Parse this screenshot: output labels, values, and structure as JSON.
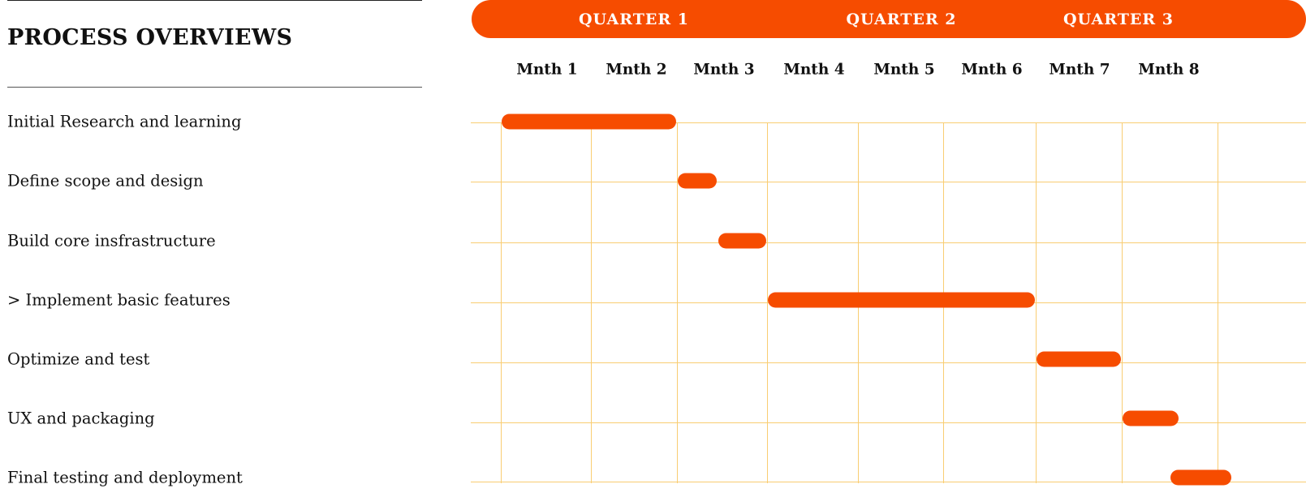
{
  "header": {
    "title": "PROCESS OVERVIEWS"
  },
  "timeline": {
    "accent_color": "#f64c00",
    "grid_color": "#f9cd72",
    "quarters": [
      {
        "label": "QUARTER 1",
        "months": [
          1,
          3
        ]
      },
      {
        "label": "QUARTER 2",
        "months": [
          4,
          6
        ]
      },
      {
        "label": "QUARTER 3",
        "months": [
          7,
          9
        ]
      }
    ],
    "months": [
      "Mnth 1",
      "Mnth 2",
      "Mnth 3",
      "Mnth 4",
      "Mnth 5",
      "Mnth 6",
      "Mnth 7",
      "Mnth 8"
    ]
  },
  "tasks": [
    {
      "label": "Initial Research and learning",
      "start_month": 1.0,
      "end_month": 3.0
    },
    {
      "label": "Define scope and design",
      "start_month": 3.0,
      "end_month": 3.45
    },
    {
      "label": "Build core insfrastructure",
      "start_month": 3.45,
      "end_month": 4.0
    },
    {
      "label": "> Implement basic features",
      "start_month": 4.0,
      "end_month": 7.0
    },
    {
      "label": "Optimize and test",
      "start_month": 7.0,
      "end_month": 8.0
    },
    {
      "label": "UX and packaging",
      "start_month": 8.0,
      "end_month": 8.6
    },
    {
      "label": "Final testing and deployment",
      "start_month": 8.5,
      "end_month": 9.15
    }
  ]
}
